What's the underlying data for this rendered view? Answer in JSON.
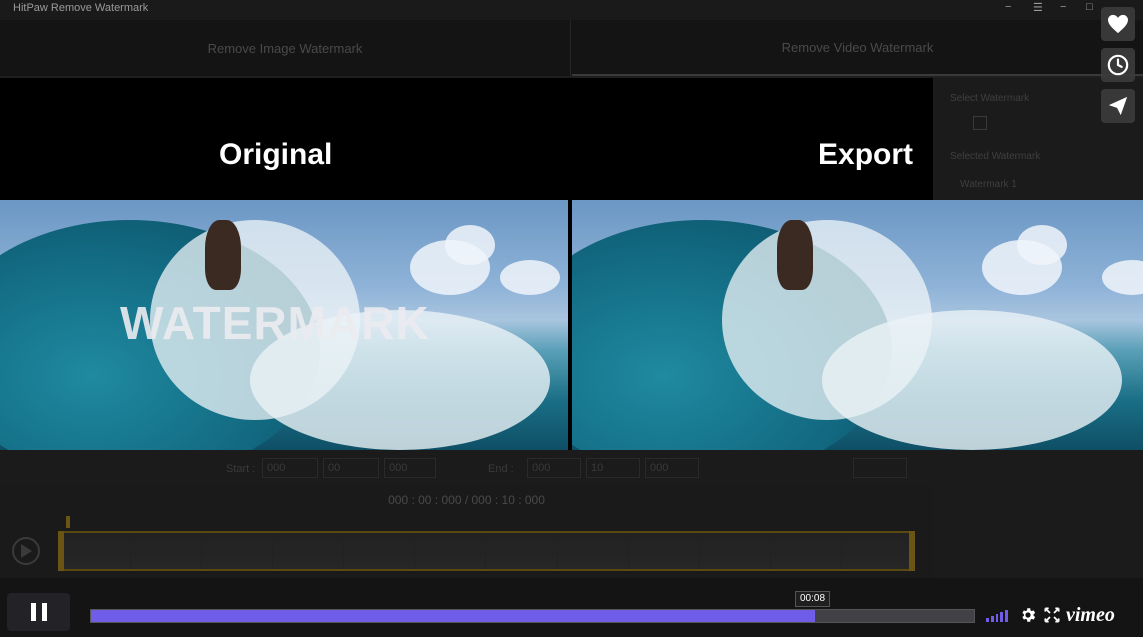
{
  "app": {
    "title": "HitPaw Remove Watermark",
    "window_controls": [
      "−",
      "☰",
      "−",
      "□"
    ],
    "tabs": [
      {
        "label": "Remove Image Watermark"
      },
      {
        "label": "Remove Video Watermark"
      }
    ],
    "side_panel": {
      "select_label": "Select Watermark",
      "selected_label": "Selected Watermark",
      "item_label": "Watermark 1"
    },
    "time_row": {
      "start_label": "Start :",
      "start_values": [
        "000",
        "00",
        "000"
      ],
      "end_label": "End :",
      "end_values": [
        "000",
        "10",
        "000"
      ]
    },
    "timecode": "000 : 00 : 000 / 000 : 10 : 000"
  },
  "compare": {
    "original_label": "Original",
    "export_label": "Export",
    "watermark_text": "WATERMARK"
  },
  "player": {
    "progress_fraction": 0.82,
    "tooltip_time": "00:08",
    "brand": "vimeo",
    "accent": "#6f5ce8",
    "side_buttons": [
      "heart-icon",
      "clock-icon",
      "send-icon"
    ]
  }
}
